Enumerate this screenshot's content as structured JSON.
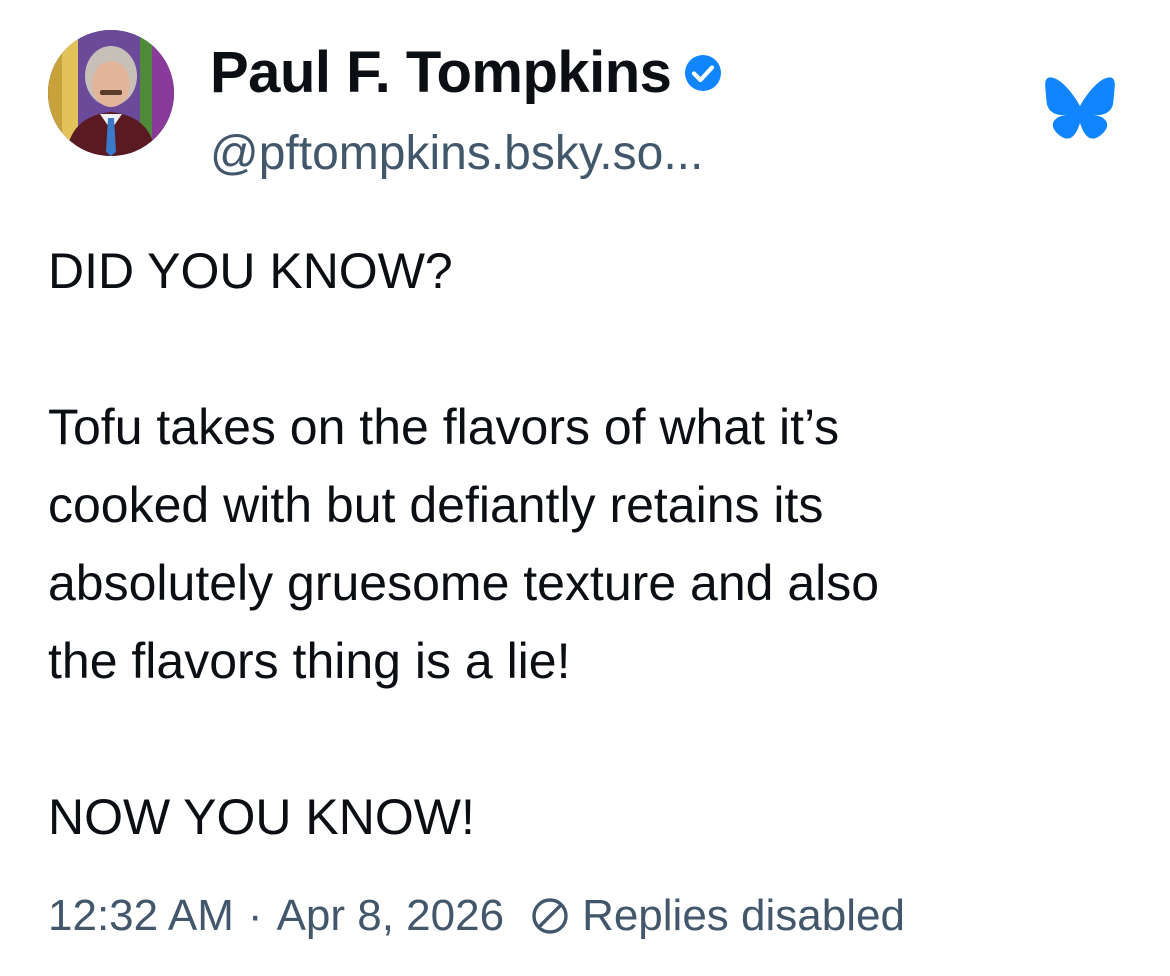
{
  "author": {
    "display_name": "Paul F. Tompkins",
    "handle": "@pftompkins.bsky.so...",
    "verified": true,
    "verified_color": "#1185fe"
  },
  "post": {
    "lines": [
      "DID YOU KNOW?",
      "",
      "Tofu takes on the flavors of what it’s",
      "cooked with but defiantly retains its",
      "absolutely gruesome texture and also",
      "the flavors thing is a lie!",
      "",
      "NOW YOU KNOW!"
    ]
  },
  "meta": {
    "time": "12:32 AM",
    "separator": "·",
    "date": "Apr 8, 2026",
    "replies_status": "Replies disabled"
  },
  "icons": {
    "verified": "verified-check-icon",
    "brand": "bluesky-butterfly-icon",
    "replies": "no-entry-icon"
  },
  "colors": {
    "text_primary": "#0b0f14",
    "text_secondary": "#42576c",
    "brand_blue": "#1185fe"
  }
}
